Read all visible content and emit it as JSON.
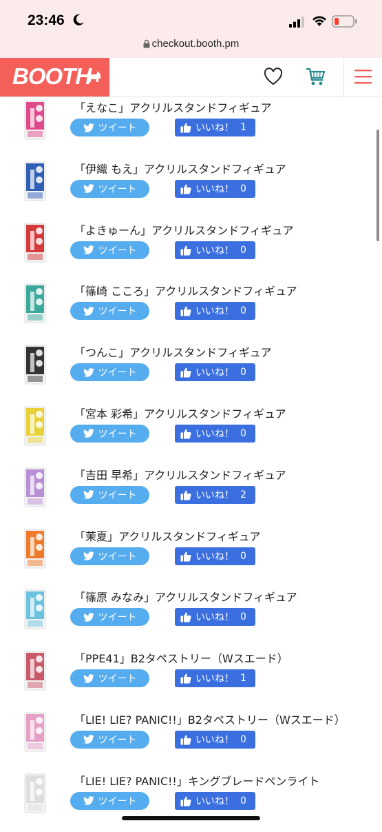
{
  "status_bar": {
    "time": "23:46",
    "url": "checkout.booth.pm",
    "background_color": "#fbeceb"
  },
  "header": {
    "logo_text": "BOOTH",
    "brand_color": "#f45f5a",
    "accent_color": "#2a8a8e",
    "icons": [
      "heart-icon",
      "cart-icon",
      "menu-icon"
    ]
  },
  "buttons": {
    "tweet_color": "#55acee",
    "like_color": "#3b6fe0"
  },
  "items": [
    {
      "title": "「えなこ」アクリルスタンドフィギュア",
      "tweet_label": "ツイート",
      "like_label": "いいね！",
      "like_count": "1",
      "thumb_color": "#e04a8c"
    },
    {
      "title": "「伊織 もえ」アクリルスタンドフィギュア",
      "tweet_label": "ツイート",
      "like_label": "いいね！",
      "like_count": "0",
      "thumb_color": "#2f5fb5"
    },
    {
      "title": "「よきゅーん」アクリルスタンドフィギュア",
      "tweet_label": "ツイート",
      "like_label": "いいね！",
      "like_count": "0",
      "thumb_color": "#d43a3a"
    },
    {
      "title": "「篠崎 こころ」アクリルスタンドフィギュア",
      "tweet_label": "ツイート",
      "like_label": "いいね！",
      "like_count": "0",
      "thumb_color": "#3aa89a"
    },
    {
      "title": "「つんこ」アクリルスタンドフィギュア",
      "tweet_label": "ツイート",
      "like_label": "いいね！",
      "like_count": "0",
      "thumb_color": "#333333"
    },
    {
      "title": "「宮本 彩希」アクリルスタンドフィギュア",
      "tweet_label": "ツイート",
      "like_label": "いいね！",
      "like_count": "0",
      "thumb_color": "#e8d23a"
    },
    {
      "title": "「吉田 早希」アクリルスタンドフィギュア",
      "tweet_label": "ツイート",
      "like_label": "いいね！",
      "like_count": "2",
      "thumb_color": "#b98fd6"
    },
    {
      "title": "「茉夏」アクリルスタンドフィギュア",
      "tweet_label": "ツイート",
      "like_label": "いいね！",
      "like_count": "0",
      "thumb_color": "#ee7a2a"
    },
    {
      "title": "「篠原 みなみ」アクリルスタンドフィギュア",
      "tweet_label": "ツイート",
      "like_label": "いいね！",
      "like_count": "0",
      "thumb_color": "#6cc3e0"
    },
    {
      "title": "「PPE41」B2タペストリー（Wスエード）",
      "tweet_label": "ツイート",
      "like_label": "いいね！",
      "like_count": "1",
      "thumb_color": "#c85a6a"
    },
    {
      "title": "「LIE! LIE? PANIC!!」B2タペストリー（Wスエード）",
      "tweet_label": "ツイート",
      "like_label": "いいね！",
      "like_count": "0",
      "thumb_color": "#e6a0c8"
    },
    {
      "title": "「LIE! LIE? PANIC!!」キングブレードペンライト",
      "tweet_label": "ツイート",
      "like_label": "いいね！",
      "like_count": "0",
      "thumb_color": "#dddddd"
    }
  ]
}
